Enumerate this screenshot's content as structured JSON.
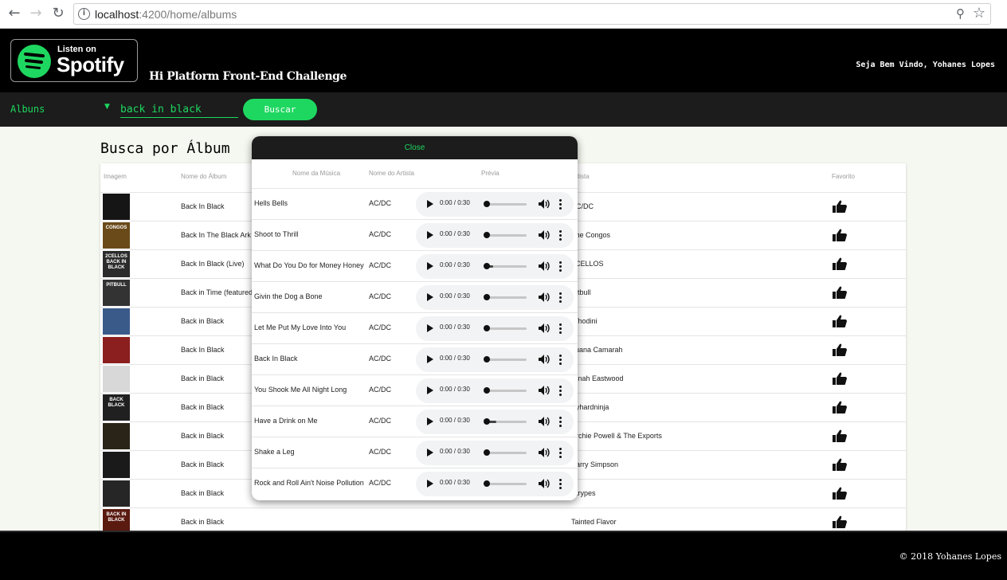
{
  "browser": {
    "url_host": "localhost",
    "url_path": ":4200/home/albums",
    "back_icon": "arrow-left-icon",
    "forward_icon": "arrow-right-icon",
    "reload_icon": "reload-icon"
  },
  "header": {
    "logo_top": "Listen on",
    "logo_brand": "Spotify",
    "challenge_title": "Hi Platform Front-End Challenge",
    "welcome": "Seja Bem Vindo, Yohanes Lopes"
  },
  "searchbar": {
    "dropdown_value": "Albuns",
    "query": "back in black",
    "search_button": "Buscar"
  },
  "main": {
    "title": "Busca por Álbum",
    "columns": {
      "image": "Imagem",
      "album": "Nome do Álbum",
      "artist": "Artista",
      "favorite": "Favorito"
    },
    "rows": [
      {
        "album": "Back In Black",
        "artist": "AC/DC",
        "thumb": ""
      },
      {
        "album": "Back In The Black Ark",
        "artist": "The Congos",
        "thumb": "CONGOS"
      },
      {
        "album": "Back In Black (Live)",
        "artist": "2CELLOS",
        "thumb": "2CELLOS BACK IN BLACK"
      },
      {
        "album": "Back in Time (featured",
        "artist": "Pitbull",
        "thumb": "PITBULL"
      },
      {
        "album": "Back in Black",
        "artist": "Whodini",
        "thumb": ""
      },
      {
        "album": "Back In Black",
        "artist": "Luana Camarah",
        "thumb": ""
      },
      {
        "album": "Back in Black",
        "artist": "Dinah Eastwood",
        "thumb": ""
      },
      {
        "album": "Back in Black",
        "artist": "Ayhardninja",
        "thumb": "BACK BLACK"
      },
      {
        "album": "Back in Black",
        "artist": "Archie Powell & The Exports",
        "thumb": ""
      },
      {
        "album": "Back in Black",
        "artist": "Barry Simpson",
        "thumb": ""
      },
      {
        "album": "Back in Black",
        "artist": "Strypes",
        "thumb": ""
      },
      {
        "album": "Back in Black",
        "artist": "Tainted Flavor",
        "thumb": "BACK IN BLACK"
      }
    ]
  },
  "modal": {
    "close_label": "Close",
    "columns": {
      "song": "Nome da Música",
      "artist": "Nome do Artista",
      "preview": "Prévia"
    },
    "tracks": [
      {
        "name": "Hells Bells",
        "artist": "AC/DC",
        "time": "0:00 / 0:30"
      },
      {
        "name": "Shoot to Thrill",
        "artist": "AC/DC",
        "time": "0:00 / 0:30"
      },
      {
        "name": "What Do You Do for Money Honey",
        "artist": "AC/DC",
        "time": "0:00 / 0:30"
      },
      {
        "name": "Givin the Dog a Bone",
        "artist": "AC/DC",
        "time": "0:00 / 0:30"
      },
      {
        "name": "Let Me Put My Love Into You",
        "artist": "AC/DC",
        "time": "0:00 / 0:30"
      },
      {
        "name": "Back In Black",
        "artist": "AC/DC",
        "time": "0:00 / 0:30"
      },
      {
        "name": "You Shook Me All Night Long",
        "artist": "AC/DC",
        "time": "0:00 / 0:30"
      },
      {
        "name": "Have a Drink on Me",
        "artist": "AC/DC",
        "time": "0:00 / 0:30"
      },
      {
        "name": "Shake a Leg",
        "artist": "AC/DC",
        "time": "0:00 / 0:30"
      },
      {
        "name": "Rock and Roll Ain't Noise Pollution",
        "artist": "AC/DC",
        "time": "0:00 / 0:30"
      }
    ]
  },
  "footer": {
    "copyright": "© 2018 Yohanes Lopes"
  },
  "colors": {
    "accent": "#1ed760",
    "header_bg": "#000000",
    "searchbar_bg": "#1b1c1b"
  }
}
